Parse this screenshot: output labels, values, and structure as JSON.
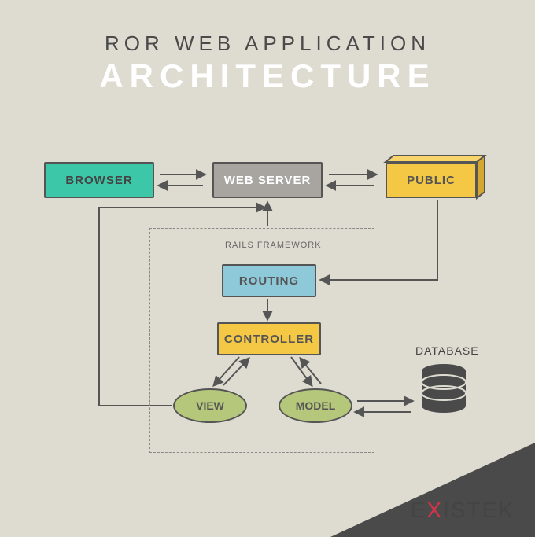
{
  "title": {
    "line1": "ROR WEB APPLICATION",
    "line2": "ARCHITECTURE"
  },
  "nodes": {
    "browser": "BROWSER",
    "webserver": "WEB SERVER",
    "public": "PUBLIC",
    "routing": "ROUTING",
    "controller": "CONTROLLER",
    "view": "VIEW",
    "model": "MODEL"
  },
  "labels": {
    "rails": "RAILS FRAMEWORK",
    "database": "DATABASE"
  },
  "logo": {
    "part1": "E",
    "x": "X",
    "part2": "ISTEK"
  },
  "colors": {
    "bg": "#dedbd1",
    "browser": "#3cc8a8",
    "webserver": "#a8a5a0",
    "public": "#f4c745",
    "routing": "#8ec9d9",
    "controller": "#f4c745",
    "mvc": "#b5c77a",
    "accent": "#d4334a"
  }
}
